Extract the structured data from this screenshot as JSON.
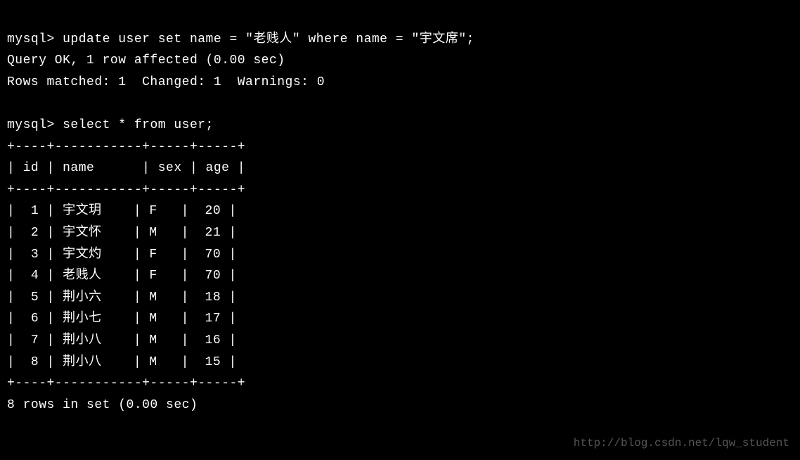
{
  "terminal": {
    "prompt1": "mysql> ",
    "command1": "update user set name = \"老贱人\" where name = \"宇文席\";",
    "result1_line1": "Query OK, 1 row affected (0.00 sec)",
    "result1_line2": "Rows matched: 1  Changed: 1  Warnings: 0",
    "blank1": "",
    "prompt2": "mysql> ",
    "command2": "select * from user;",
    "table_border": "+----+-----------+-----+-----+",
    "table_header": "| id | name      | sex | age |",
    "rows": [
      "|  1 | 宇文玥    | F   |  20 |",
      "|  2 | 宇文怀    | M   |  21 |",
      "|  3 | 宇文灼    | F   |  70 |",
      "|  4 | 老贱人    | F   |  70 |",
      "|  5 | 荆小六    | M   |  18 |",
      "|  6 | 荆小七    | M   |  17 |",
      "|  7 | 荆小八    | M   |  16 |",
      "|  8 | 荆小八    | M   |  15 |"
    ],
    "result2": "8 rows in set (0.00 sec)"
  },
  "chart_data": {
    "type": "table",
    "title": "user",
    "columns": [
      "id",
      "name",
      "sex",
      "age"
    ],
    "rows": [
      {
        "id": 1,
        "name": "宇文玥",
        "sex": "F",
        "age": 20
      },
      {
        "id": 2,
        "name": "宇文怀",
        "sex": "M",
        "age": 21
      },
      {
        "id": 3,
        "name": "宇文灼",
        "sex": "F",
        "age": 70
      },
      {
        "id": 4,
        "name": "老贱人",
        "sex": "F",
        "age": 70
      },
      {
        "id": 5,
        "name": "荆小六",
        "sex": "M",
        "age": 18
      },
      {
        "id": 6,
        "name": "荆小七",
        "sex": "M",
        "age": 17
      },
      {
        "id": 7,
        "name": "荆小八",
        "sex": "M",
        "age": 16
      },
      {
        "id": 8,
        "name": "荆小八",
        "sex": "M",
        "age": 15
      }
    ]
  },
  "watermark": "http://blog.csdn.net/lqw_student"
}
